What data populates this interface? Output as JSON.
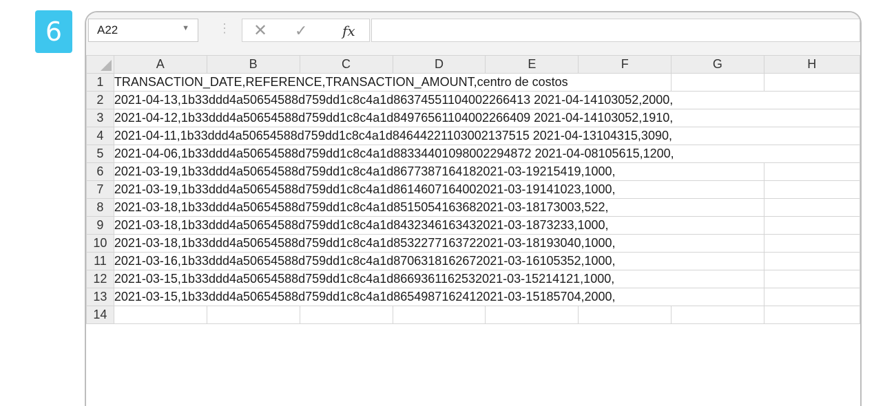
{
  "step_number": "6",
  "formula_bar": {
    "name_box": "A22",
    "fx_label": "fx",
    "formula": ""
  },
  "columns": [
    "A",
    "B",
    "C",
    "D",
    "E",
    "F",
    "G",
    "H"
  ],
  "rows": [
    {
      "num": "1",
      "text": "TRANSACTION_DATE,REFERENCE,TRANSACTION_AMOUNT,centro de costos",
      "span": 6
    },
    {
      "num": "2",
      "text": "2021-04-13,1b33ddd4a50654588d759dd1c8c4a1d86374551104002266413 2021-04-14103052,2000,",
      "span": 8
    },
    {
      "num": "3",
      "text": "2021-04-12,1b33ddd4a50654588d759dd1c8c4a1d84976561104002266409 2021-04-14103052,1910,",
      "span": 8
    },
    {
      "num": "4",
      "text": "2021-04-11,1b33ddd4a50654588d759dd1c8c4a1d84644221103002137515 2021-04-13104315,3090,",
      "span": 8
    },
    {
      "num": "5",
      "text": "2021-04-06,1b33ddd4a50654588d759dd1c8c4a1d88334401098002294872 2021-04-08105615,1200,",
      "span": 8
    },
    {
      "num": "6",
      "text": "2021-03-19,1b33ddd4a50654588d759dd1c8c4a1d8677387164182021-03-19215419,1000,",
      "span": 7
    },
    {
      "num": "7",
      "text": "2021-03-19,1b33ddd4a50654588d759dd1c8c4a1d8614607164002021-03-19141023,1000,",
      "span": 7
    },
    {
      "num": "8",
      "text": "2021-03-18,1b33ddd4a50654588d759dd1c8c4a1d8515054163682021-03-18173003,522,",
      "span": 7
    },
    {
      "num": "9",
      "text": "2021-03-18,1b33ddd4a50654588d759dd1c8c4a1d8432346163432021-03-1873233,1000,",
      "span": 7
    },
    {
      "num": "10",
      "text": "2021-03-18,1b33ddd4a50654588d759dd1c8c4a1d8532277163722021-03-18193040,1000,",
      "span": 7
    },
    {
      "num": "11",
      "text": "2021-03-16,1b33ddd4a50654588d759dd1c8c4a1d8706318162672021-03-16105352,1000,",
      "span": 7
    },
    {
      "num": "12",
      "text": "2021-03-15,1b33ddd4a50654588d759dd1c8c4a1d8669361162532021-03-15214121,1000,",
      "span": 7
    },
    {
      "num": "13",
      "text": "2021-03-15,1b33ddd4a50654588d759dd1c8c4a1d8654987162412021-03-15185704,2000,",
      "span": 7
    },
    {
      "num": "14",
      "text": "",
      "span": 1
    }
  ]
}
